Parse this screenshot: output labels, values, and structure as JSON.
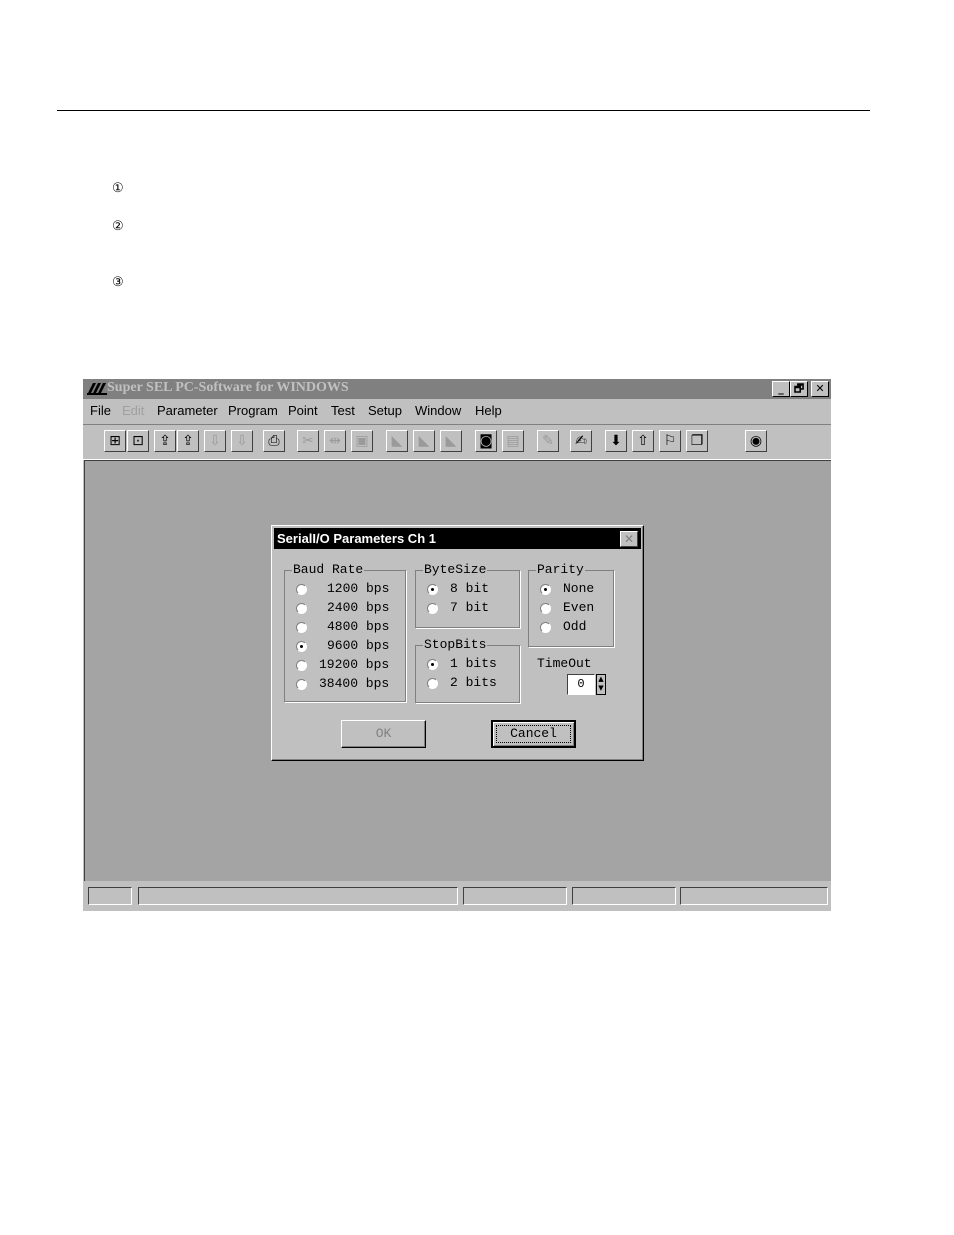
{
  "steps": [
    "①",
    "②",
    "③"
  ],
  "window": {
    "title": "Super SEL PC-Software for WINDOWS",
    "controls": {
      "minimize": "_",
      "restore": "🗗",
      "close": "✕"
    },
    "menu": [
      {
        "label": "File",
        "enabled": true
      },
      {
        "label": "Edit",
        "enabled": false
      },
      {
        "label": "Parameter",
        "enabled": true
      },
      {
        "label": "Program",
        "enabled": true
      },
      {
        "label": "Point",
        "enabled": true
      },
      {
        "label": "Test",
        "enabled": true
      },
      {
        "label": "Setup",
        "enabled": true
      },
      {
        "label": "Window",
        "enabled": true
      },
      {
        "label": "Help",
        "enabled": true
      }
    ],
    "toolbar_icons": [
      "new-program-icon",
      "new-point-icon",
      "upload-program-icon",
      "upload-point-icon",
      "download-program-icon",
      "download-point-icon",
      "print-icon",
      "cut-icon",
      "copy-icon",
      "paste-icon",
      "insert-row-icon",
      "delete-row-icon",
      "clear-row-icon",
      "run-icon",
      "step-icon",
      "edit-icon",
      "monitor-icon",
      "down-arrow-icon",
      "up-arrow-icon",
      "flag-icon",
      "window-icon",
      "stop-icon"
    ]
  },
  "dialog": {
    "title": "SerialI/O Parameters Ch 1",
    "baud_rate": {
      "label": "Baud Rate",
      "options": [
        "1200 bps",
        "2400 bps",
        "4800 bps",
        "9600 bps",
        "19200 bps",
        "38400 bps"
      ],
      "selected": "9600 bps"
    },
    "byte_size": {
      "label": "ByteSize",
      "options": [
        "8 bit",
        "7 bit"
      ],
      "selected": "8 bit"
    },
    "stop_bits": {
      "label": "StopBits",
      "options": [
        "1 bits",
        "2 bits"
      ],
      "selected": "1 bits"
    },
    "parity": {
      "label": "Parity",
      "options": [
        "None",
        "Even",
        "Odd"
      ],
      "selected": "None"
    },
    "timeout": {
      "label": "TimeOut",
      "value": "0"
    },
    "ok_label": "OK",
    "cancel_label": "Cancel"
  }
}
